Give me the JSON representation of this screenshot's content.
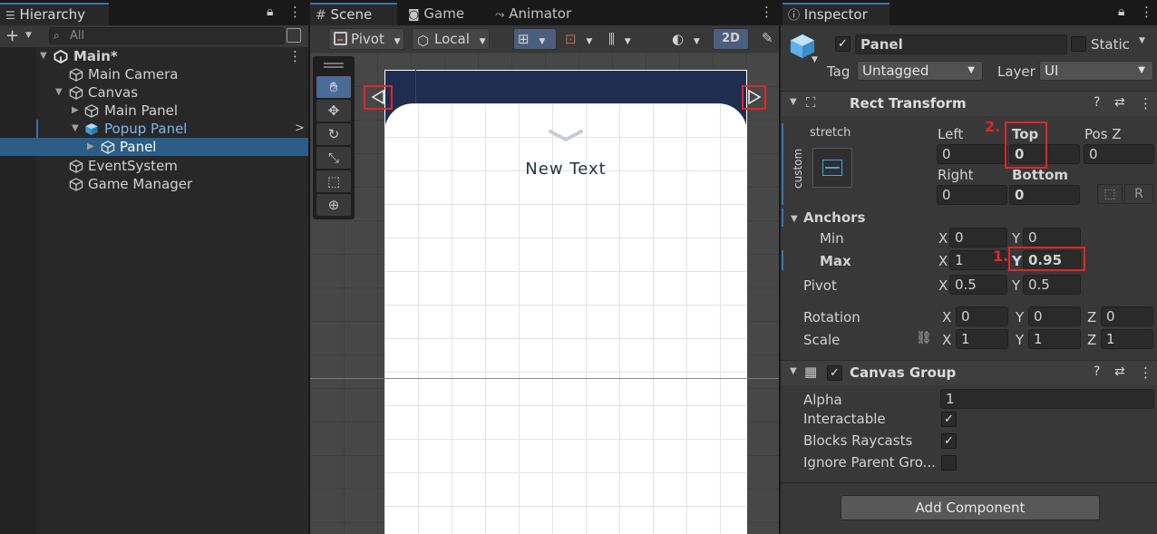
{
  "hierarchy": {
    "tab": "Hierarchy",
    "search_placeholder": "All",
    "items": [
      {
        "label": "Main*"
      },
      {
        "label": "Main Camera"
      },
      {
        "label": "Canvas"
      },
      {
        "label": "Main Panel"
      },
      {
        "label": "Popup Panel"
      },
      {
        "label": "Panel"
      },
      {
        "label": "EventSystem"
      },
      {
        "label": "Game Manager"
      }
    ]
  },
  "scene": {
    "tabs": [
      "Scene",
      "Game",
      "Animator"
    ],
    "pivot_label": "Pivot",
    "local_label": "Local",
    "mode_2d": "2D",
    "canvas_text": "New Text"
  },
  "inspector": {
    "tab": "Inspector",
    "object_name": "Panel",
    "static_label": "Static",
    "tag_label": "Tag",
    "tag_value": "Untagged",
    "layer_label": "Layer",
    "layer_value": "UI",
    "rect_transform": {
      "title": "Rect Transform",
      "stretch_label": "stretch",
      "custom_label": "custom",
      "left_label": "Left",
      "left_value": "0",
      "top_label": "Top",
      "top_value": "0",
      "posz_label": "Pos Z",
      "posz_value": "0",
      "right_label": "Right",
      "right_value": "0",
      "bottom_label": "Bottom",
      "bottom_value": "0",
      "anchors_label": "Anchors",
      "min_label": "Min",
      "min_x": "0",
      "min_y": "0",
      "max_label": "Max",
      "max_x": "1",
      "max_y": "0.95",
      "pivot_label": "Pivot",
      "pivot_x": "0.5",
      "pivot_y": "0.5",
      "rotation_label": "Rotation",
      "rot_x": "0",
      "rot_y": "0",
      "rot_z": "0",
      "scale_label": "Scale",
      "scale_x": "1",
      "scale_y": "1",
      "scale_z": "1",
      "x": "X",
      "y": "Y",
      "z": "Z",
      "marker_1": "1.",
      "marker_2": "2."
    },
    "canvas_group": {
      "title": "Canvas Group",
      "alpha_label": "Alpha",
      "alpha_value": "1",
      "interactable_label": "Interactable",
      "blocks_label": "Blocks Raycasts",
      "ignore_label": "Ignore Parent Gro..."
    },
    "add_component": "Add Component"
  },
  "colors": {
    "selection": "#2c5d87",
    "accent_blue": "#3a72b0",
    "annotation_red": "#e02727",
    "canvas_navy": "#1f2d4e"
  }
}
